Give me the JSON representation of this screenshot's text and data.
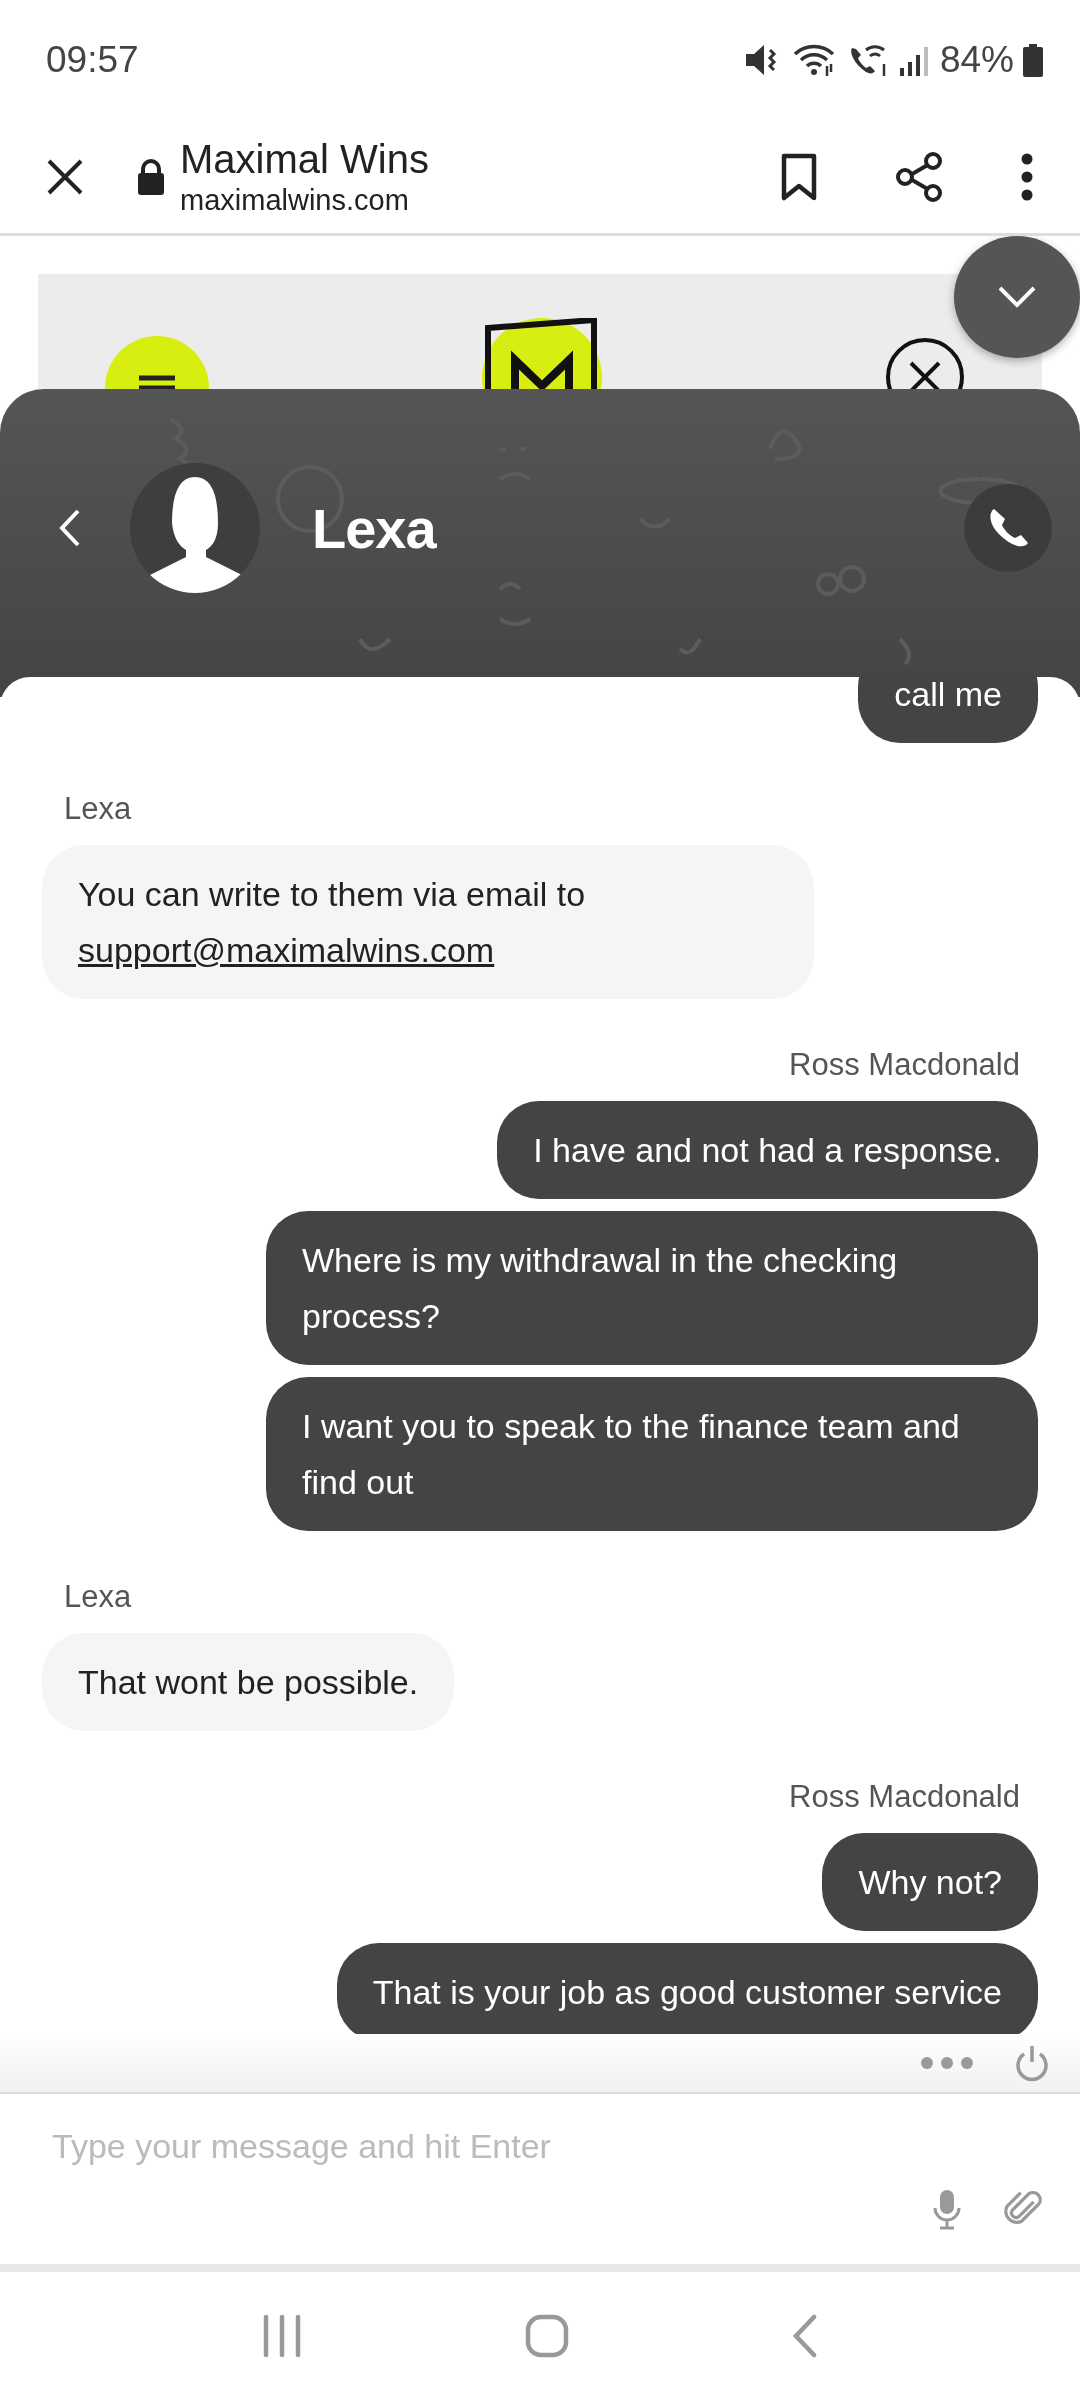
{
  "status_bar": {
    "time": "09:57",
    "battery": "84%"
  },
  "browser_bar": {
    "title": "Maximal Wins",
    "url": "maximalwins.com"
  },
  "chat_header": {
    "name": "Lexa"
  },
  "groups": [
    {
      "kind": "user",
      "messages": [
        {
          "text": "call me"
        }
      ]
    },
    {
      "kind": "agent",
      "author": "Lexa",
      "messages": [
        {
          "text": "You can write to them via email to",
          "link": "support@maximalwins.com"
        }
      ]
    },
    {
      "kind": "user",
      "author": "Ross Macdonald",
      "messages": [
        {
          "text": "I have and not had a response."
        },
        {
          "text": "Where is my withdrawal in the checking process?"
        },
        {
          "text": "I want you to speak to the finance team and find out"
        }
      ]
    },
    {
      "kind": "agent",
      "author": "Lexa",
      "messages": [
        {
          "text": "That wont be possible."
        }
      ]
    },
    {
      "kind": "user",
      "author": "Ross Macdonald",
      "messages": [
        {
          "text": "Why not?"
        },
        {
          "text": "That is your job as good customer service"
        }
      ]
    }
  ],
  "composer": {
    "placeholder": "Type your message and hit Enter"
  }
}
